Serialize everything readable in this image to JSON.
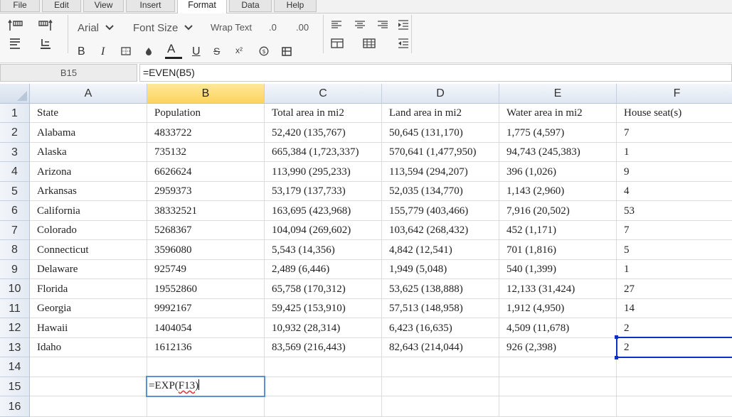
{
  "menu": {
    "tabs": [
      "File",
      "Edit",
      "View",
      "Insert",
      "Format",
      "Data",
      "Help"
    ],
    "active": "Format"
  },
  "toolbar": {
    "font_name": "Arial",
    "font_size": "Font Size",
    "wrap_text": "Wrap Text",
    "decrease_decimal": ".0",
    "increase_decimal": ".00",
    "bold": "B",
    "italic": "I",
    "strikethrough": "S",
    "superscript": "x²",
    "font_color": "A",
    "underline": "U",
    "currency": "$",
    "icons": [
      "insert-row-above-icon",
      "insert-column-icon",
      "insert-row-below-icon",
      "delete-row-icon",
      "borders-icon",
      "fill-color-icon",
      "merge-cells-icon",
      "align-left-icon",
      "align-center-icon",
      "align-right-icon",
      "indent-icon",
      "outdent-icon",
      "table-icon",
      "grid-icon"
    ]
  },
  "formula_bar": {
    "cell_ref": "B15",
    "formula": "=EVEN(B5)"
  },
  "sheet": {
    "columns": [
      "A",
      "B",
      "C",
      "D",
      "E",
      "F"
    ],
    "selected_column": "B",
    "row_numbers": [
      "1",
      "2",
      "3",
      "4",
      "5",
      "6",
      "7",
      "8",
      "9",
      "10",
      "11",
      "12",
      "13",
      "14",
      "15",
      "16"
    ],
    "rows": [
      [
        "State",
        "Population",
        "Total area in mi2",
        "Land area in mi2",
        "Water area in mi2",
        "House seat(s)"
      ],
      [
        "Alabama",
        "4833722",
        "52,420 (135,767)",
        "50,645 (131,170)",
        "1,775 (4,597)",
        "7"
      ],
      [
        "Alaska",
        "735132",
        "665,384 (1,723,337)",
        "570,641 (1,477,950)",
        "94,743 (245,383)",
        "1"
      ],
      [
        "Arizona",
        "6626624",
        "113,990 (295,233)",
        "113,594 (294,207)",
        "396 (1,026)",
        "9"
      ],
      [
        "Arkansas",
        "2959373",
        "53,179 (137,733)",
        "52,035 (134,770)",
        "1,143 (2,960)",
        "4"
      ],
      [
        "California",
        "38332521",
        "163,695 (423,968)",
        "155,779 (403,466)",
        "7,916 (20,502)",
        "53"
      ],
      [
        "Colorado",
        "5268367",
        "104,094 (269,602)",
        "103,642 (268,432)",
        "452 (1,171)",
        "7"
      ],
      [
        "Connecticut",
        "3596080",
        "5,543 (14,356)",
        "4,842 (12,541)",
        "701 (1,816)",
        "5"
      ],
      [
        "Delaware",
        "925749",
        "2,489 (6,446)",
        "1,949 (5,048)",
        "540 (1,399)",
        "1"
      ],
      [
        "Florida",
        "19552860",
        "65,758 (170,312)",
        "53,625 (138,888)",
        "12,133 (31,424)",
        "27"
      ],
      [
        "Georgia",
        "9992167",
        "59,425 (153,910)",
        "57,513 (148,958)",
        "1,912 (4,950)",
        "14"
      ],
      [
        "Hawaii",
        "1404054",
        "10,932 (28,314)",
        "6,423 (16,635)",
        "4,509 (11,678)",
        "2"
      ],
      [
        "Idaho",
        "1612136",
        "83,569 (216,443)",
        "82,643 (214,044)",
        "926 (2,398)",
        "2"
      ]
    ],
    "editing_cell": {
      "ref": "B15",
      "prefix": "=EXP(",
      "argument": "F13",
      "suffix": ")"
    },
    "selected_cell": "F13"
  },
  "colors": {
    "selected_header": "#fcd45e",
    "selection_border": "#0d2fc6",
    "edit_border": "#5b8fd6"
  }
}
